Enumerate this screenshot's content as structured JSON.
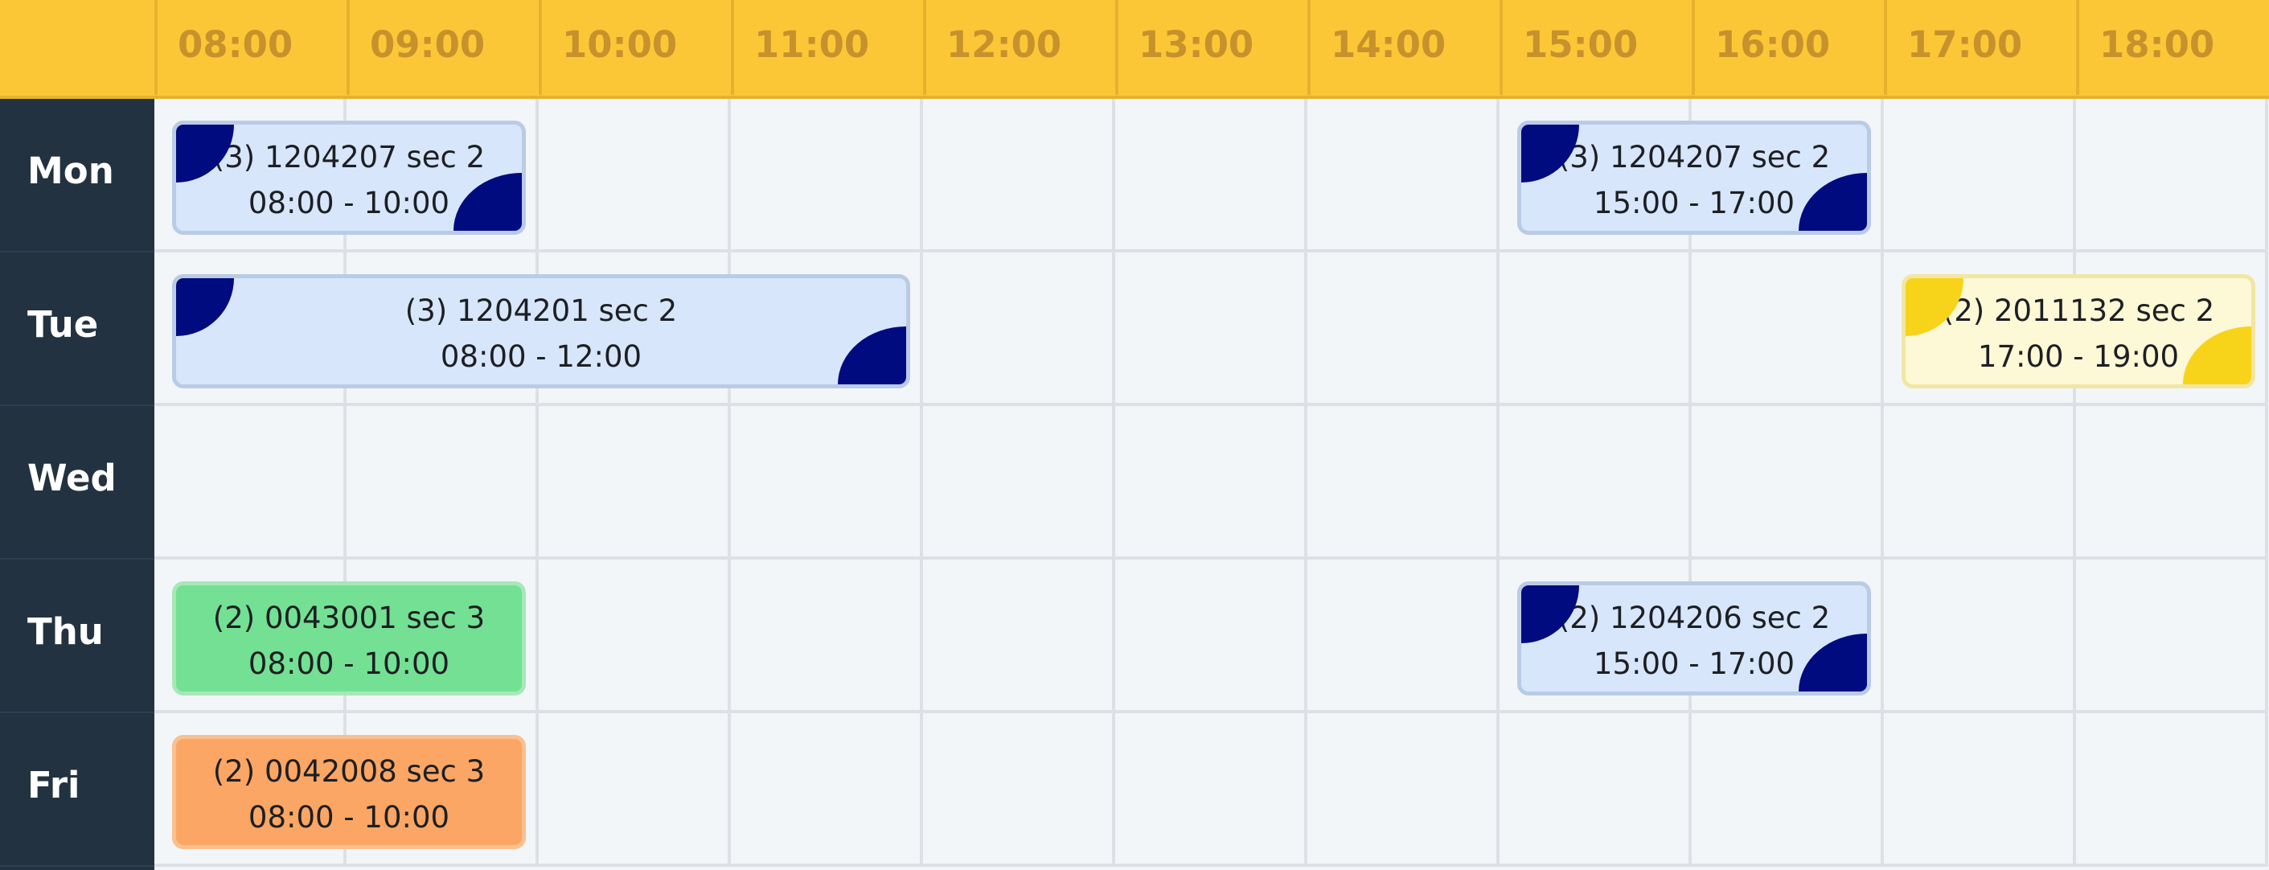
{
  "hours": [
    "08:00",
    "09:00",
    "10:00",
    "11:00",
    "12:00",
    "13:00",
    "14:00",
    "15:00",
    "16:00",
    "17:00",
    "18:00"
  ],
  "days": [
    "Mon",
    "Tue",
    "Wed",
    "Thu",
    "Fri"
  ],
  "events": [
    {
      "day": 0,
      "start": 8,
      "end": 10,
      "title": "(3) 1204207 sec 2",
      "time": "08:00 - 10:00",
      "bg": "#d7e6fb",
      "border": "#b9cbe6",
      "corner": "#000b80"
    },
    {
      "day": 0,
      "start": 15,
      "end": 17,
      "title": "(3) 1204207 sec 2",
      "time": "15:00 - 17:00",
      "bg": "#d7e6fb",
      "border": "#b9cbe6",
      "corner": "#000b80"
    },
    {
      "day": 1,
      "start": 8,
      "end": 12,
      "title": "(3) 1204201 sec 2",
      "time": "08:00 - 12:00",
      "bg": "#d7e6fb",
      "border": "#b9cbe6",
      "corner": "#000b80"
    },
    {
      "day": 1,
      "start": 17,
      "end": 19,
      "title": "(2) 2011132 sec 2",
      "time": "17:00 - 19:00",
      "bg": "#fdf8d5",
      "border": "#f2e6a4",
      "corner": "#f7d31a"
    },
    {
      "day": 3,
      "start": 8,
      "end": 10,
      "title": "(2) 0043001 sec 3",
      "time": "08:00 - 10:00",
      "bg": "#73e094",
      "border": "#a6e8b8",
      "corner": null
    },
    {
      "day": 3,
      "start": 15,
      "end": 17,
      "title": "(2) 1204206 sec 2",
      "time": "15:00 - 17:00",
      "bg": "#d7e6fb",
      "border": "#b9cbe6",
      "corner": "#000b80"
    },
    {
      "day": 4,
      "start": 8,
      "end": 10,
      "title": "(2) 0042008 sec 3",
      "time": "08:00 - 10:00",
      "bg": "#fba664",
      "border": "#fbc08f",
      "corner": null
    }
  ]
}
